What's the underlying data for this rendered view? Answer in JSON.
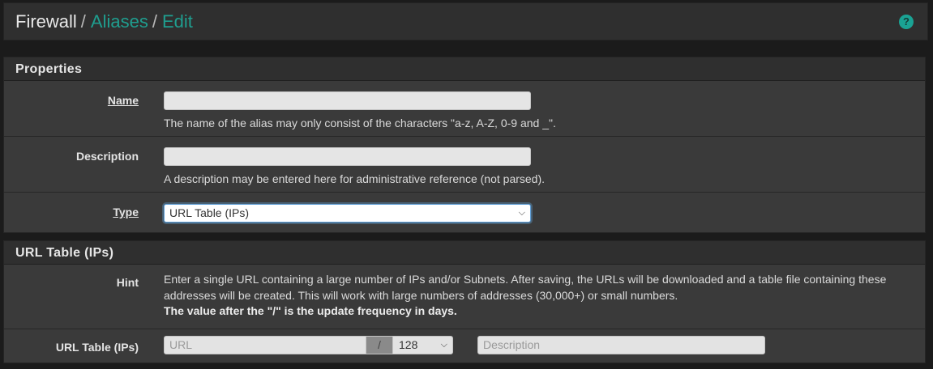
{
  "breadcrumb": {
    "root": "Firewall",
    "separator": "/",
    "items": [
      "Aliases",
      "Edit"
    ]
  },
  "header": {
    "help_icon": "question-circle-icon",
    "help_glyph": "?"
  },
  "properties_panel": {
    "title": "Properties",
    "name": {
      "label": "Name",
      "value": "",
      "help": "The name of the alias may only consist of the characters \"a-z, A-Z, 0-9 and _\"."
    },
    "description": {
      "label": "Description",
      "value": "",
      "help": "A description may be entered here for administrative reference (not parsed)."
    },
    "type": {
      "label": "Type",
      "selected": "URL Table (IPs)"
    }
  },
  "url_table_panel": {
    "title": "URL Table (IPs)",
    "hint": {
      "label": "Hint",
      "text": "Enter a single URL containing a large number of IPs and/or Subnets. After saving, the URLs will be downloaded and a table file containing these addresses will be created. This will work with large numbers of addresses (30,000+) or small numbers.",
      "bold_text": "The value after the \"/\" is the update frequency in days."
    },
    "entry": {
      "label": "URL Table (IPs)",
      "url_placeholder": "URL",
      "slash": "/",
      "frequency": "128",
      "description_placeholder": "Description"
    }
  },
  "colors": {
    "accent": "#1f9e8f",
    "background": "#1b1b1b",
    "panel": "#3a3a3a",
    "panel_heading": "#2f2f2f"
  }
}
